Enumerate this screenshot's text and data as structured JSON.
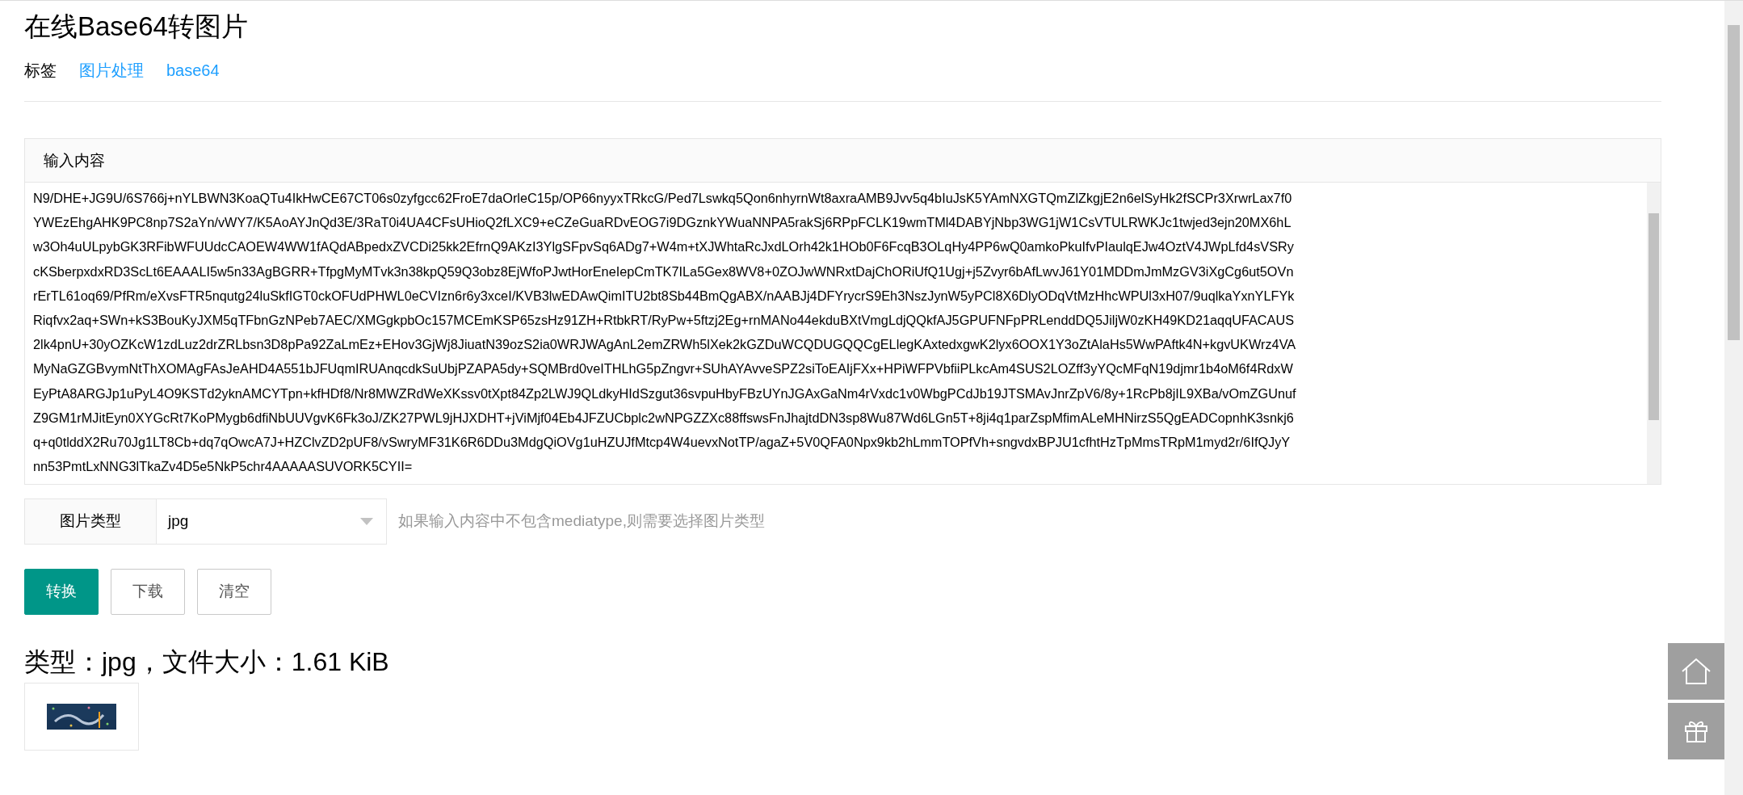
{
  "page": {
    "title": "在线Base64转图片",
    "tags_label": "标签",
    "tags": [
      "图片处理",
      "base64"
    ]
  },
  "input_panel": {
    "header": "输入内容",
    "value_lines": [
      "N9/DHE+JG9U/6S766j+nYLBWN3KoaQTu4IkHwCE67CT06s0zyfgcc62FroE7daOrleC15p/OP66nyyxTRkcG/Ped7Lswkq5Qon6nhyrnWt8axraAMB9Jvv5q4bIuJsK5YAmNXGTQmZlZkgjE2n6elSyHk2fSCPr3XrwrLax7f0",
      "YWEzEhgAHK9PC8np7S2aYn/vWY7/K5AoAYJnQd3E/3RaT0i4UA4CFsUHioQ2fLXC9+eCZeGuaRDvEOG7i9DGznkYWuaNNPA5rakSj6RPpFCLK19wmTMl4DABYjNbp3WG1jW1CsVTULRWKJc1twjed3ejn20MX6hL",
      "w3Oh4uULpybGK3RFibWFUUdcCAOEW4WW1fAQdABpedxZVCDi25kk2EfrnQ9AKzI3YlgSFpvSq6ADg7+W4m+tXJWhtaRcJxdLOrh42k1HOb0F6FcqB3OLqHy4PP6wQ0amkoPkuIfvPIaulqEJw4OztV4JWpLfd4sVSRy",
      "cKSberpxdxRD3ScLt6EAAALI5w5n33AgBGRR+TfpgMyMTvk3n38kpQ59Q3obz8EjWfoPJwtHorEneIepCmTK7ILa5Gex8WV8+0ZOJwWNRxtDajChORiUfQ1Ugj+j5Zvyr6bAfLwvJ61Y01MDDmJmMzGV3iXgCg6ut5OVn",
      "rErTL61oq69/PfRm/eXvsFTR5nqutg24luSkfIGT0ckOFUdPHWL0eCVIzn6r6y3xceI/KVB3lwEDAwQimITU2bt8Sb44BmQgABX/nAABJj4DFYrycrS9Eh3NszJynW5yPCl8X6DlyODqVtMzHhcWPUl3xH07/9uqlkaYxnYLFYk",
      "Riqfvx2aq+SWn+kS3BouKyJXM5qTFbnGzNPeb7AEC/XMGgkpbOc157MCEmKSP65zsHz91ZH+RtbkRT/RyPw+5ftzj2Eg+rnMANo44ekduBXtVmgLdjQQkfAJ5GPUFNFpPRLenddDQ5JiljW0zKH49KD21aqqUFACAUS",
      "2lk4pnU+30yOZKcW1zdLuz2drZRLbsn3D8pPa92ZaLmEz+EHov3GjWj8JiuatN39ozS2ia0WRJWAgAnL2emZRWh5lXek2kGZDuWCQDUGQQCgELlegKAxtedxgwK2lyx6OOX1Y3oZtAlaHs5WwPAftk4N+kgvUKWrz4VA",
      "MyNaGZGBvymNtThXOMAgFAsJeAHD4A551bJFUqmIRUAnqcdkSuUbjPZAPA5dy+SQMBrd0veITHLhG5pZngvr+SUhAYAvveSPZ2siToEAIjFXx+HPiWFPVbfiiPLkcAm4SUS2LOZff3yYQcMFqN19djmr1b4oM6f4RdxW",
      "EyPtA8ARGJp1uPyL4O9KSTd2yknAMCYTpn+kfHDf8/Nr8MWZRdWeXKssv0tXpt84Zp2LWJ9QLdkyHIdSzgut36svpuHbyFBzUYnJGAxGaNm4rVxdc1v0WbgPCdJb19JTSMAvJnrZpV6/8y+1RcPb8jIL9XBa/vOmZGUnuf",
      "Z9GM1rMJitEyn0XYGcRt7KoPMygb6dfiNbUUVgvK6Fk3oJ/ZK27PWL9jHJXDHT+jViMjf04Eb4JFZUCbplc2wNPGZZXc88ffswsFnJhajtdDN3sp8Wu87Wd6LGn5T+8ji4q1parZspMfimALeMHNirzS5QgEADCopnhK3snkj6",
      "q+q0tlddX2Ru70Jg1LT8Cb+dq7qOwcA7J+HZClvZD2pUF8/vSwryMF31K6R6DDu3MdgQiOVg1uHZUJfMtcp4W4uevxNotTP/agaZ+5V0QFA0Npx9kb2hLmmTOPfVh+sngvdxBPJU1cfhtHzTpMmsTRpM1myd2r/6IfQJyY",
      "nn53PmtLxNNG3lTkaZv4D5e5NkP5chr4AAAAASUVORK5CYII="
    ]
  },
  "image_type": {
    "label": "图片类型",
    "value": "jpg",
    "hint": "如果输入内容中不包含mediatype,则需要选择图片类型"
  },
  "buttons": [
    {
      "label": "转换",
      "kind": "primary"
    },
    {
      "label": "下载",
      "kind": "default"
    },
    {
      "label": "清空",
      "kind": "default"
    }
  ],
  "result": {
    "summary": "类型：jpg，文件大小：1.61 KiB"
  }
}
